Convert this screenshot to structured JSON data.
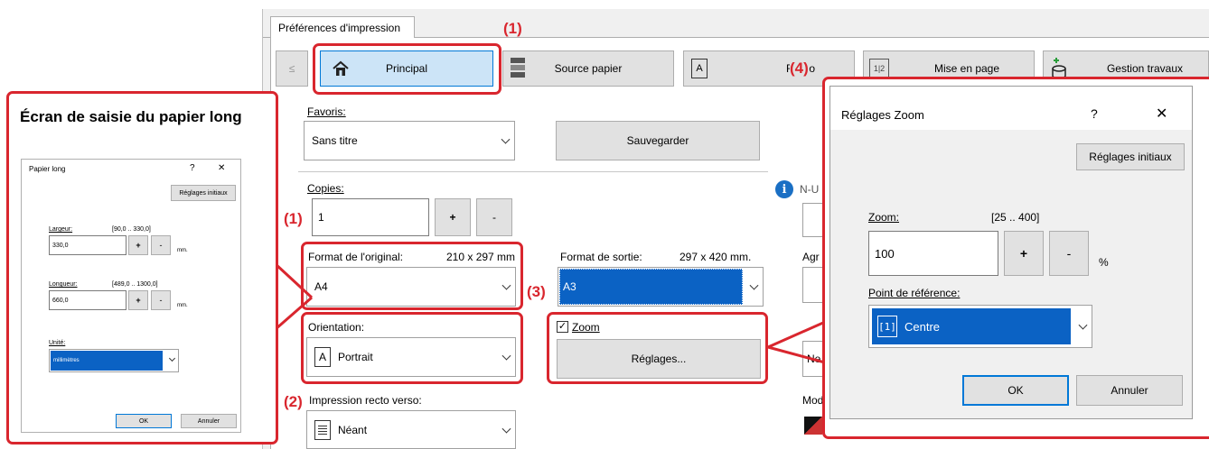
{
  "main_window": {
    "tab_label": "Préférences d'impression",
    "prev_button": "≤",
    "tabs": [
      {
        "label": "Principal"
      },
      {
        "label": "Source papier"
      },
      {
        "label": "Finitio"
      },
      {
        "label": "Mise en page"
      },
      {
        "label": "Gestion travaux"
      }
    ],
    "favorites": {
      "label": "Favoris:",
      "value": "Sans titre",
      "save_button": "Sauvegarder"
    },
    "copies": {
      "label": "Copies:",
      "value": "1",
      "plus": "+",
      "minus": "-"
    },
    "original_size": {
      "label": "Format de l'original:",
      "dims": "210 x 297 mm",
      "value": "A4"
    },
    "output_size": {
      "label": "Format de sortie:",
      "dims": "297 x 420 mm.",
      "value": "A3"
    },
    "orientation": {
      "label": "Orientation:",
      "icon": "A",
      "value": "Portrait"
    },
    "zoom": {
      "checkbox_label": "Zoom",
      "checked": true,
      "settings_button": "Réglages..."
    },
    "duplex": {
      "label": "Impression recto verso:",
      "value": "Néant"
    },
    "partial_labels": {
      "nup": "N-U",
      "agr": "Agr",
      "ne": "Ne",
      "mod": "Mod"
    }
  },
  "callouts": {
    "c1_top": "(1)",
    "c4": "(4)",
    "c1_left": "(1)",
    "c3": "(3)",
    "c2": "(2)"
  },
  "long_paper_panel": {
    "caption": "Écran de saisie du papier long",
    "dialog": {
      "title": "Papier long",
      "help": "?",
      "close": "✕",
      "reset_button": "Réglages initiaux",
      "width": {
        "label": "Largeur:",
        "range": "[90,0 .. 330,0]",
        "value": "330,0",
        "unit": "mm."
      },
      "length": {
        "label": "Longueur:",
        "range": "[489,0 .. 1300,0]",
        "value": "660,0",
        "unit": "mm."
      },
      "unit": {
        "label": "Unité:",
        "value": "millimètres"
      },
      "plus": "+",
      "minus": "-",
      "ok_button": "OK",
      "cancel_button": "Annuler"
    }
  },
  "zoom_dialog": {
    "title": "Réglages Zoom",
    "help": "?",
    "close": "✕",
    "reset_button": "Réglages initiaux",
    "zoom_label": "Zoom:",
    "range": "[25 .. 400]",
    "value": "100",
    "plus": "+",
    "minus": "-",
    "unit": "%",
    "ref_label": "Point de référence:",
    "ref_value": "Centre",
    "ok_button": "OK",
    "cancel_button": "Annuler"
  },
  "colors": {
    "callout_red": "#d9262e",
    "selection_blue": "#0b62c4",
    "tab_active": "#cce4f7"
  }
}
